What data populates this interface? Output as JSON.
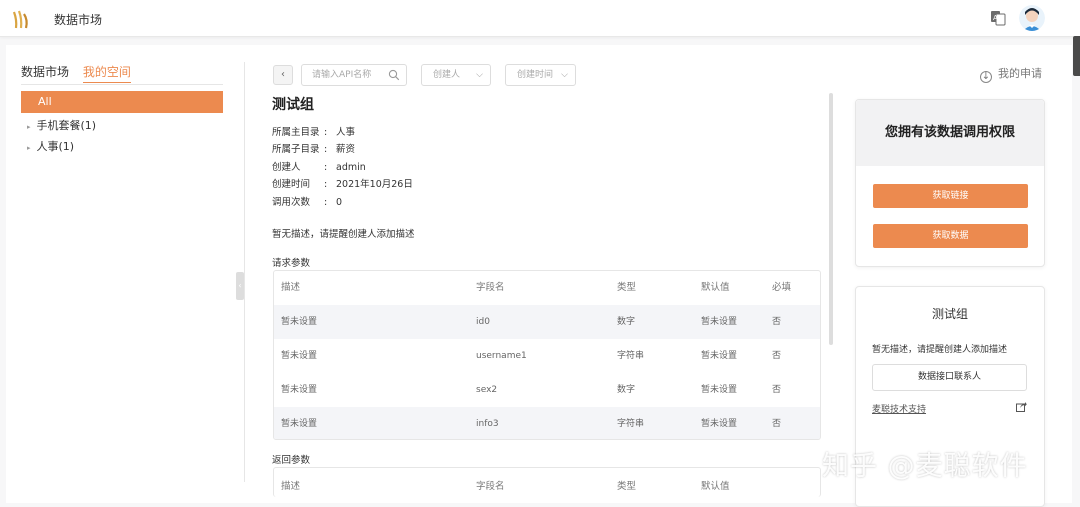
{
  "header": {
    "app_title": "数据市场"
  },
  "sidebar": {
    "tabs": [
      "数据市场",
      "我的空间"
    ],
    "items": [
      {
        "label": "All"
      },
      {
        "label": "手机套餐(1)"
      },
      {
        "label": "人事(1)"
      }
    ]
  },
  "toolbar": {
    "search_placeholder": "请输入API名称",
    "creator_select": "创建人",
    "time_select": "创建时间",
    "my_apply": "我的申请"
  },
  "detail": {
    "title": "测试组",
    "meta": [
      {
        "key": "所属主目录",
        "value": "人事"
      },
      {
        "key": "所属子目录",
        "value": "薪资"
      },
      {
        "key": "创建人",
        "value": "admin"
      },
      {
        "key": "创建时间",
        "value": "2021年10月26日"
      },
      {
        "key": "调用次数",
        "value": "0"
      }
    ],
    "description": "暂无描述，请提醒创建人添加描述",
    "request_params_label": "请求参数",
    "return_params_label": "返回参数",
    "table_headers": [
      "描述",
      "字段名",
      "类型",
      "默认值",
      "必填"
    ],
    "request_rows": [
      [
        "暂未设置",
        "id0",
        "数字",
        "暂未设置",
        "否"
      ],
      [
        "暂未设置",
        "username1",
        "字符串",
        "暂未设置",
        "否"
      ],
      [
        "暂未设置",
        "sex2",
        "数字",
        "暂未设置",
        "否"
      ],
      [
        "暂未设置",
        "info3",
        "字符串",
        "暂未设置",
        "否"
      ]
    ],
    "return_headers": [
      "描述",
      "字段名",
      "类型",
      "默认值"
    ]
  },
  "permission_card": {
    "title": "您拥有该数据调用权限",
    "get_link": "获取链接",
    "get_data": "获取数据"
  },
  "info_card": {
    "title": "测试组",
    "description": "暂无描述，请提醒创建人添加描述",
    "contact_button": "数据接口联系人",
    "tech_support": "麦聪技术支持"
  },
  "watermark": "知乎 @麦聪软件",
  "colors": {
    "accent": "#ec8a4f"
  }
}
